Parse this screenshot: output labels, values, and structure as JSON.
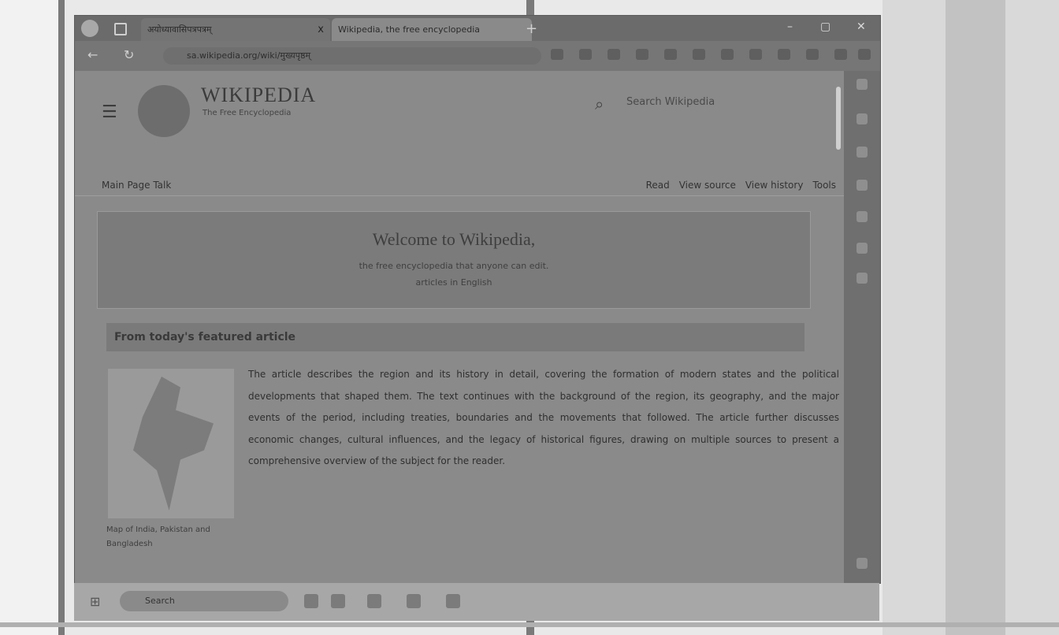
{
  "browser": {
    "tabs": [
      {
        "label": "अयोध्यावासिपत्रपत्रम्",
        "close": "x"
      },
      {
        "label": "Wikipedia, the free encyclopedia",
        "close": ""
      }
    ],
    "new_tab": "+",
    "window_controls": {
      "minimize": "–",
      "maximize": "▢",
      "close": "✕"
    },
    "url": "sa.wikipedia.org/wiki/मुख्यपृष्ठम्"
  },
  "page": {
    "brand": "WIKIPEDIA",
    "tagline": "The Free Encyclopedia",
    "search_placeholder": "Search Wikipedia",
    "subnav": {
      "left": "Main Page   Talk",
      "right": [
        "Read",
        "View source",
        "View history",
        "Tools"
      ]
    },
    "welcome": {
      "title": "Welcome to Wikipedia,",
      "line1": "the free encyclopedia that anyone can edit.",
      "line2": "articles in English"
    },
    "featured_heading": "From today's featured article",
    "featured_caption": "Map of India, Pakistan and Bangladesh",
    "article_text": "The article describes the region and its history in detail, covering the formation of modern states and the political developments that shaped them. The text continues with the background of the region, its geography, and the major events of the period, including treaties, boundaries and the movements that followed. The article further discusses economic changes, cultural influences, and the legacy of historical figures, drawing on multiple sources to present a comprehensive overview of the subject for the reader."
  },
  "taskbar": {
    "search_label": "Search"
  },
  "icons": {
    "menu": "menu-icon",
    "search": "search-icon",
    "back": "back-icon",
    "refresh": "refresh-icon"
  }
}
